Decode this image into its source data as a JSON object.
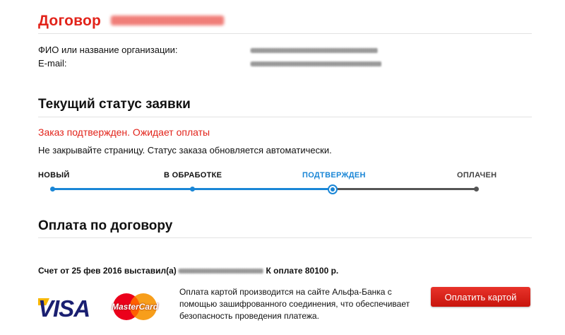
{
  "contract": {
    "title": "Договор",
    "fio_label": "ФИО или название организации:",
    "email_label": "E-mail:"
  },
  "status_section": {
    "title": "Текущий статус заявки",
    "status_text": "Заказ подтвержден. Ожидает оплаты",
    "note": "Не закрывайте страницу. Статус заказа обновляется автоматически.",
    "steps": [
      {
        "label": "НОВЫЙ",
        "state": "done"
      },
      {
        "label": "В ОБРАБОТКЕ",
        "state": "done"
      },
      {
        "label": "ПОДТВЕРЖДЕН",
        "state": "current"
      },
      {
        "label": "ОПЛАЧЕН",
        "state": "pending"
      }
    ]
  },
  "payment_section": {
    "title": "Оплата по договору",
    "invoice_prefix": "Счет от 25 фев 2016 выставил(а)",
    "invoice_suffix": "К оплате 80100 р.",
    "card_info": "Оплата картой производится на сайте Альфа-Банка с помощью зашифрованного соединения, что обеспечивает безопасность проведения платежа.",
    "pay_button": "Оплатить картой",
    "visa_logo": "VISA",
    "mastercard_logo": "MasterCard"
  },
  "colors": {
    "brand_red": "#e2231a",
    "progress_blue": "#1a86d6",
    "progress_gray": "#555555"
  }
}
